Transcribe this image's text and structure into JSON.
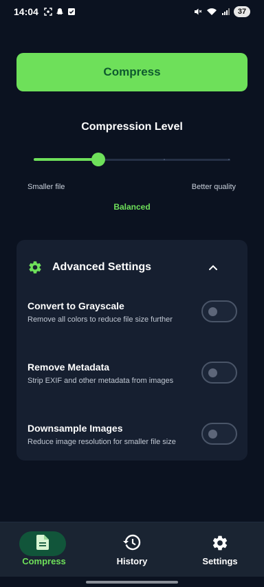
{
  "status_bar": {
    "time": "14:04",
    "battery": "37",
    "icons": [
      "screenshot-icon",
      "snapchat-icon",
      "checkbox-icon",
      "mute-icon",
      "wifi-icon",
      "signal-icon"
    ]
  },
  "main": {
    "compress_button": "Compress",
    "compression_level": {
      "title": "Compression Level",
      "value_fraction": 0.33,
      "left_label": "Smaller file",
      "right_label": "Better quality",
      "current": "Balanced"
    },
    "advanced": {
      "title": "Advanced Settings",
      "expanded": true,
      "settings": [
        {
          "title": "Convert to Grayscale",
          "description": "Remove all colors to reduce file size further",
          "enabled": false
        },
        {
          "title": "Remove Metadata",
          "description": "Strip EXIF and other metadata from images",
          "enabled": false
        },
        {
          "title": "Downsample Images",
          "description": "Reduce image resolution for smaller file size",
          "enabled": false
        }
      ]
    }
  },
  "bottom_nav": {
    "items": [
      {
        "label": "Compress",
        "icon": "document-icon",
        "active": true
      },
      {
        "label": "History",
        "icon": "history-icon",
        "active": false
      },
      {
        "label": "Settings",
        "icon": "gear-icon",
        "active": false
      }
    ]
  },
  "colors": {
    "background": "#0b1220",
    "accent": "#6ee05a",
    "accent_text": "#0e5a2e",
    "card": "#161f30",
    "nav": "#1a2432"
  }
}
